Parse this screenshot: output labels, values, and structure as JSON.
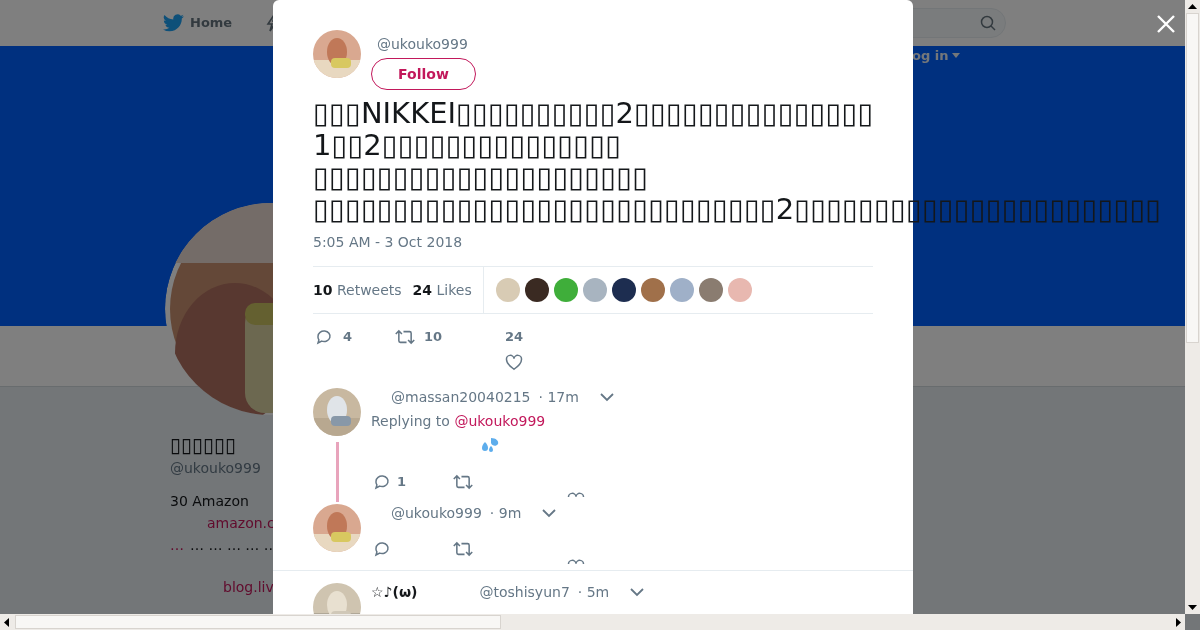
{
  "nav": {
    "home": "Home",
    "login": "og in"
  },
  "profile": {
    "name": "▯▯▯▯▯▯",
    "handle": "@ukouko999",
    "bio": "30 Amazon",
    "link1": "amazon.c",
    "dots_link": "…",
    "dots": "… … … … …",
    "link2": "blog.liv"
  },
  "tweet": {
    "handle": "@ukouko999",
    "follow": "Follow",
    "lines": [
      "▯▯▯NIKKEI▯▯▯▯▯▯▯▯▯▯2▯▯▯▯▯▯▯▯▯▯▯▯▯▯▯",
      "1▯▯2▯▯▯▯▯▯▯▯▯▯▯▯▯▯▯",
      "▯▯▯▯▯▯▯▯▯▯▯▯▯▯▯▯▯▯▯▯▯",
      "▯▯▯▯▯▯▯▯▯▯▯▯▯▯▯▯▯▯▯▯▯▯▯▯▯▯▯▯▯2▯▯▯▯▯▯▯▯▯▯▯▯▯▯▯▯▯▯▯▯▯▯▯"
    ],
    "time": "5:05 AM - 3 Oct 2018",
    "retweets": {
      "count": "10",
      "label": "Retweets"
    },
    "likes": {
      "count": "24",
      "label": "Likes"
    },
    "likers": [
      {
        "color": "#d8cbb4"
      },
      {
        "color": "#3a2a22"
      },
      {
        "color": "#3fae3a"
      },
      {
        "color": "#a8b4c0"
      },
      {
        "color": "#1d2d50"
      },
      {
        "color": "#a0704a"
      },
      {
        "color": "#9fb0c8"
      },
      {
        "color": "#8a7c70"
      },
      {
        "color": "#e8b8b0"
      }
    ],
    "actions": {
      "replies": "4",
      "retweets": "10",
      "likes": "24"
    }
  },
  "replies": [
    {
      "handle": "@massan20040215",
      "time": "· 17m",
      "replying_label": "Replying to",
      "replying_to": "@ukouko999",
      "body": [
        {
          "kind": "droplets"
        }
      ],
      "show_actions": true,
      "reply_count": "1",
      "thread": true
    },
    {
      "handle": "@ukouko999",
      "time": "· 9m",
      "show_actions": true,
      "thread": false
    },
    {
      "name": "☆♪(ω)",
      "handle": "@toshisyun7",
      "time": "· 5m",
      "show_actions": false,
      "thread": false
    }
  ]
}
